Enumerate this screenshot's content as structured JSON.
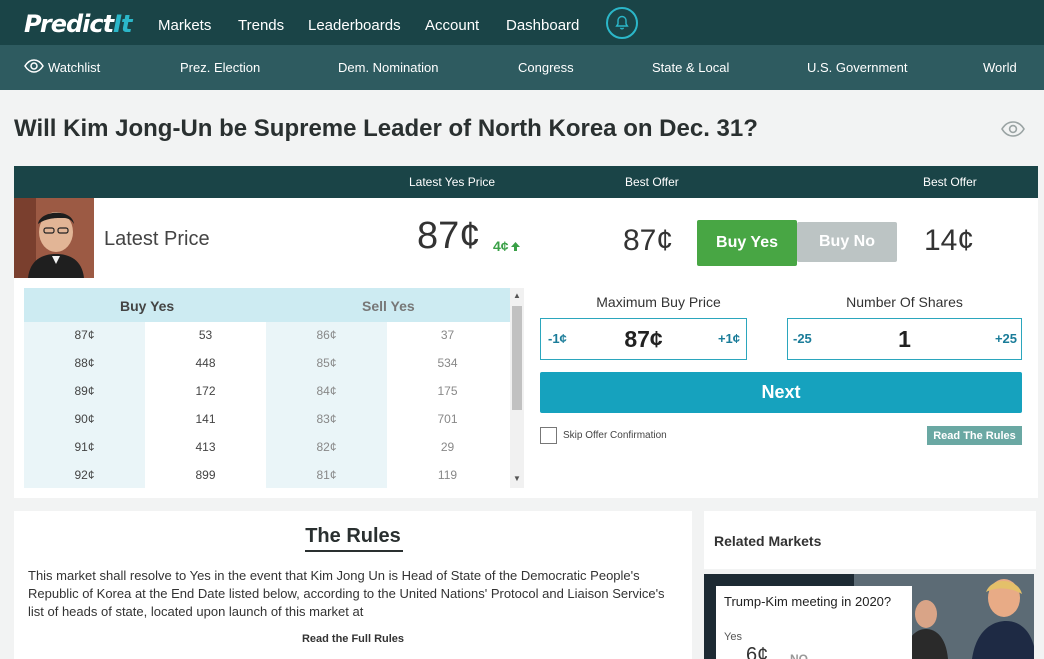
{
  "brand": {
    "logo_main": "Predict",
    "logo_accent": "It"
  },
  "topnav": {
    "items": [
      "Markets",
      "Trends",
      "Leaderboards",
      "Account",
      "Dashboard"
    ]
  },
  "subnav": {
    "watchlist": "Watchlist",
    "items": [
      "Prez. Election",
      "Dem. Nomination",
      "Congress",
      "State & Local",
      "U.S. Government",
      "World"
    ]
  },
  "market": {
    "title": "Will Kim Jong-Un be Supreme Leader of North Korea on Dec. 31?",
    "header": {
      "latest_yes_price": "Latest Yes Price",
      "best_offer_yes": "Best Offer",
      "best_offer_no": "Best Offer"
    },
    "latest_price_label": "Latest Price",
    "latest_price": "87¢",
    "change": "4¢",
    "best_offer_yes": "87¢",
    "best_offer_no": "14¢",
    "buy_yes": "Buy Yes",
    "buy_no": "Buy No"
  },
  "order_book": {
    "buy_header": "Buy Yes",
    "sell_header": "Sell Yes",
    "rows": [
      {
        "buy_price": "87¢",
        "buy_qty": "53",
        "sell_price": "86¢",
        "sell_qty": "37"
      },
      {
        "buy_price": "88¢",
        "buy_qty": "448",
        "sell_price": "85¢",
        "sell_qty": "534"
      },
      {
        "buy_price": "89¢",
        "buy_qty": "172",
        "sell_price": "84¢",
        "sell_qty": "175"
      },
      {
        "buy_price": "90¢",
        "buy_qty": "141",
        "sell_price": "83¢",
        "sell_qty": "701"
      },
      {
        "buy_price": "91¢",
        "buy_qty": "413",
        "sell_price": "82¢",
        "sell_qty": "29"
      },
      {
        "buy_price": "92¢",
        "buy_qty": "899",
        "sell_price": "81¢",
        "sell_qty": "119"
      }
    ]
  },
  "order_form": {
    "max_price_label": "Maximum Buy Price",
    "shares_label": "Number Of Shares",
    "price_dec": "-1¢",
    "price_value": "87¢",
    "price_inc": "+1¢",
    "shares_dec": "-25",
    "shares_value": "1",
    "shares_inc": "+25",
    "next": "Next",
    "skip_confirmation": "Skip Offer Confirmation",
    "read_rules": "Read The Rules"
  },
  "rules": {
    "title": "The Rules",
    "text": "This market shall resolve to Yes in the event that Kim Jong Un is Head of State of the Democratic People's Republic of Korea at the End Date listed below, according to the United Nations' Protocol and Liaison Service's list of heads of state, located upon launch of this market at",
    "read_full": "Read the Full Rules"
  },
  "related": {
    "title": "Related Markets",
    "item": {
      "title": "Trump-Kim meeting in 2020?",
      "yes_label": "Yes",
      "price": "6¢",
      "no_label": "NO"
    }
  },
  "colors": {
    "nav": "#1a4447",
    "subnav": "#2e5b60",
    "accent": "#16a2be",
    "buy_yes": "#48a644"
  }
}
